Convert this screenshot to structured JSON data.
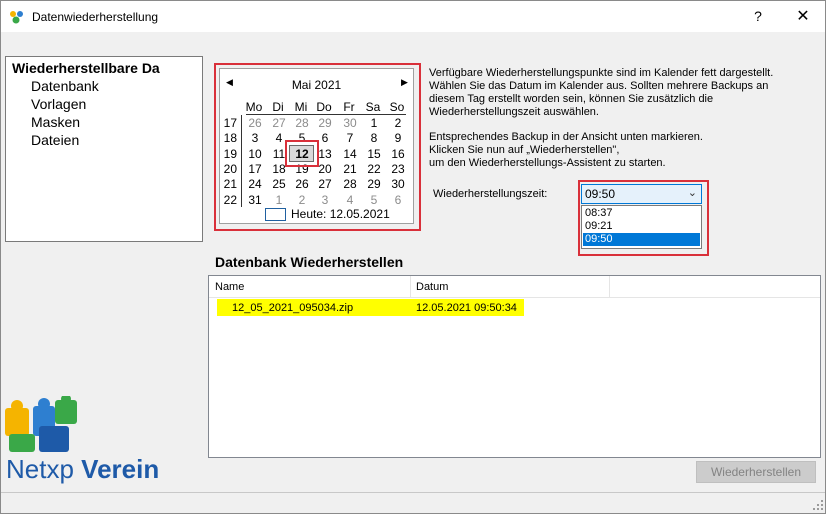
{
  "window": {
    "title": "Datenwiederherstellung",
    "help": "?",
    "close": "✕"
  },
  "tree": {
    "root": "Wiederherstellbare Da",
    "items": [
      "Datenbank",
      "Vorlagen",
      "Masken",
      "Dateien"
    ]
  },
  "calendar": {
    "month": "Mai 2021",
    "prev": "◀",
    "next": "▶",
    "weekdays": [
      "Mo",
      "Di",
      "Mi",
      "Do",
      "Fr",
      "Sa",
      "So"
    ],
    "weeks": [
      {
        "wk": "17",
        "days": [
          "26",
          "27",
          "28",
          "29",
          "30",
          "1",
          "2"
        ]
      },
      {
        "wk": "18",
        "days": [
          "3",
          "4",
          "5",
          "6",
          "7",
          "8",
          "9"
        ]
      },
      {
        "wk": "19",
        "days": [
          "10",
          "11",
          "12",
          "13",
          "14",
          "15",
          "16"
        ]
      },
      {
        "wk": "20",
        "days": [
          "17",
          "18",
          "19",
          "20",
          "21",
          "22",
          "23"
        ]
      },
      {
        "wk": "21",
        "days": [
          "24",
          "25",
          "26",
          "27",
          "28",
          "29",
          "30"
        ]
      },
      {
        "wk": "22",
        "days": [
          "31",
          "1",
          "2",
          "3",
          "4",
          "5",
          "6"
        ]
      }
    ],
    "selected": "12",
    "today": "Heute: 12.05.2021"
  },
  "info": {
    "lines": [
      "Verfügbare Wiederherstellungspunkte sind im Kalender fett dargestellt.",
      "Wählen Sie das Datum im Kalender aus. Sollten mehrere Backups an",
      "diesem Tag erstellt worden sein, können Sie zusätzlich die",
      "Wiederherstellungszeit auswählen.",
      "",
      "Entsprechendes Backup in der Ansicht unten markieren.",
      "Klicken Sie nun auf „Wiederherstellen\",",
      "um den Wiederherstellungs-Assistent zu starten."
    ]
  },
  "time": {
    "label": "Wiederherstellungszeit:",
    "value": "09:50",
    "options": [
      "08:37",
      "09:21",
      "09:50"
    ]
  },
  "section": {
    "title": "Datenbank Wiederherstellen"
  },
  "table": {
    "columns": [
      "Name",
      "Datum"
    ],
    "rows": [
      {
        "name": "12_05_2021_095034.zip",
        "datum": "12.05.2021 09:50:34"
      }
    ]
  },
  "buttons": {
    "restore": "Wiederherstellen"
  },
  "logo": {
    "text_a": "Netxp",
    "text_b": "Verein"
  },
  "colors": {
    "highlight_border": "#d9303a",
    "row_highlight": "#ffff00",
    "selection": "#0078d7",
    "logo_blue": "#1e5aa8"
  }
}
